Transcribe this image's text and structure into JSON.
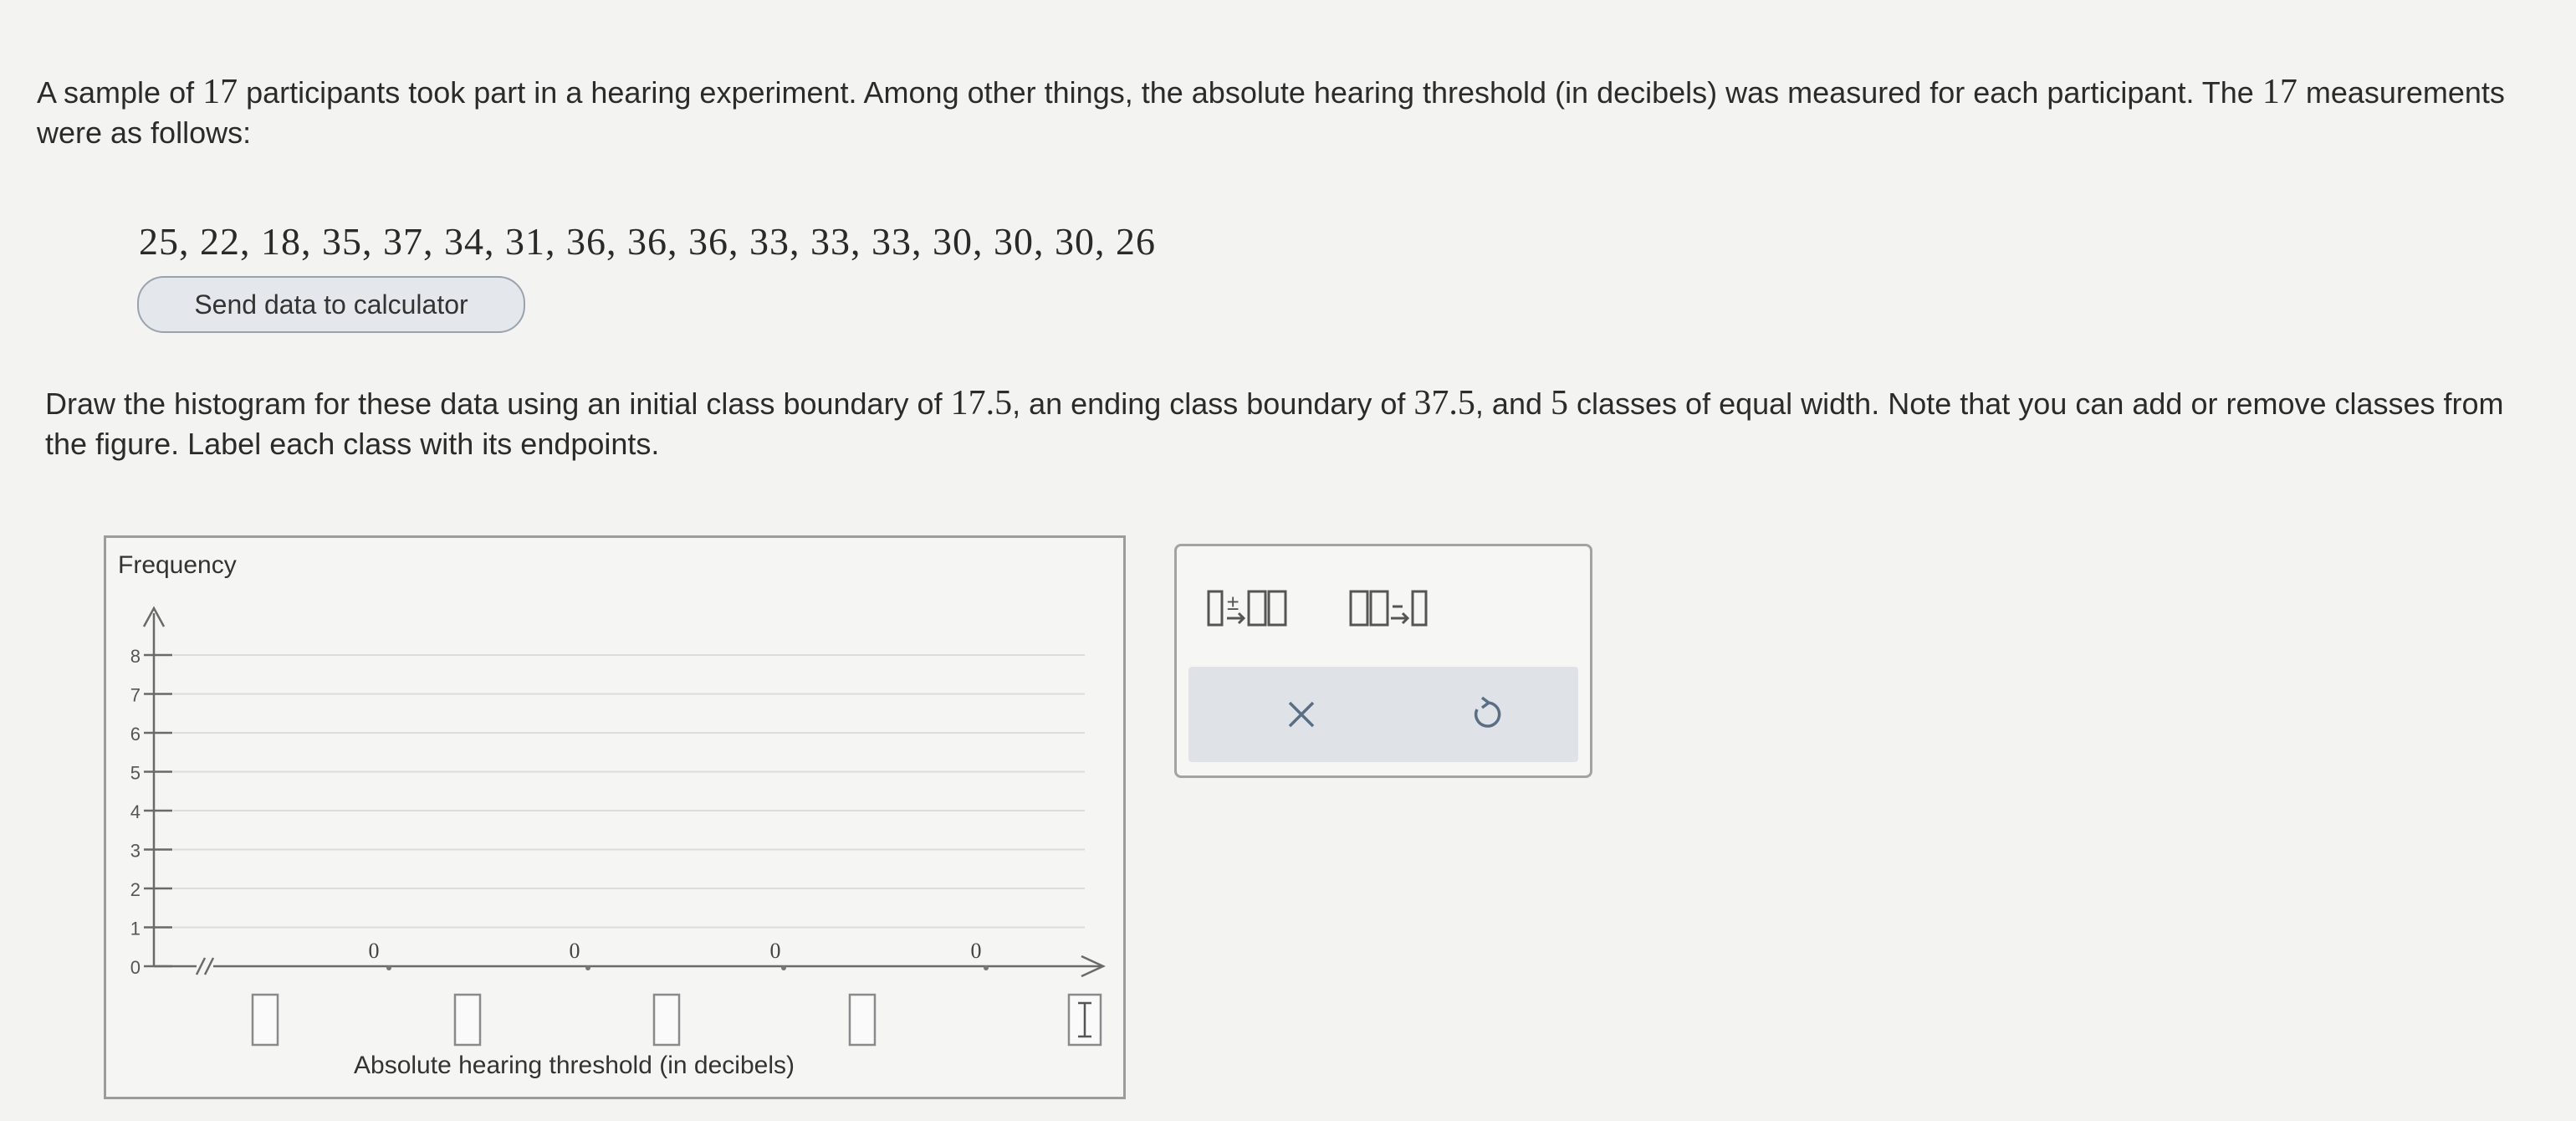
{
  "intro": {
    "t1": "A sample of ",
    "n1": "17",
    "t2": " participants took part in a hearing experiment. Among other things, the absolute hearing threshold (in decibels) was measured for each participant. The ",
    "n2": "17",
    "t3": " measurements were as follows:"
  },
  "data_values_text": "25, 22, 18, 35, 37, 34, 31, 36, 36, 36, 33, 33, 33, 30, 30, 30, 26",
  "send_button_label": "Send data to calculator",
  "instructions": {
    "t1": "Draw the histogram for these data using an initial class boundary of ",
    "n1": "17.5",
    "t2": ", an ending class boundary of ",
    "n2": "37.5",
    "t3": ", and ",
    "n3": "5",
    "t4": " classes of equal width. Note that you can add or remove classes from the figure. Label each class with its endpoints."
  },
  "graph": {
    "ylabel": "Frequency",
    "xlabel": "Absolute hearing threshold (in decibels)",
    "y_ticks": [
      "0",
      "1",
      "2",
      "3",
      "4",
      "5",
      "6",
      "7",
      "8"
    ],
    "bar_count_labels": [
      "0",
      "0",
      "0",
      "0"
    ]
  },
  "tools": {
    "add_icon": "add-class-icon",
    "remove_icon": "remove-class-icon",
    "clear_icon": "close-icon",
    "undo_icon": "undo-icon"
  },
  "colors": {
    "axis": "#6a6a6a",
    "grid": "#dcdcdc",
    "panel_bg": "#dfe3e8",
    "button_bg": "#e4e8ec"
  }
}
